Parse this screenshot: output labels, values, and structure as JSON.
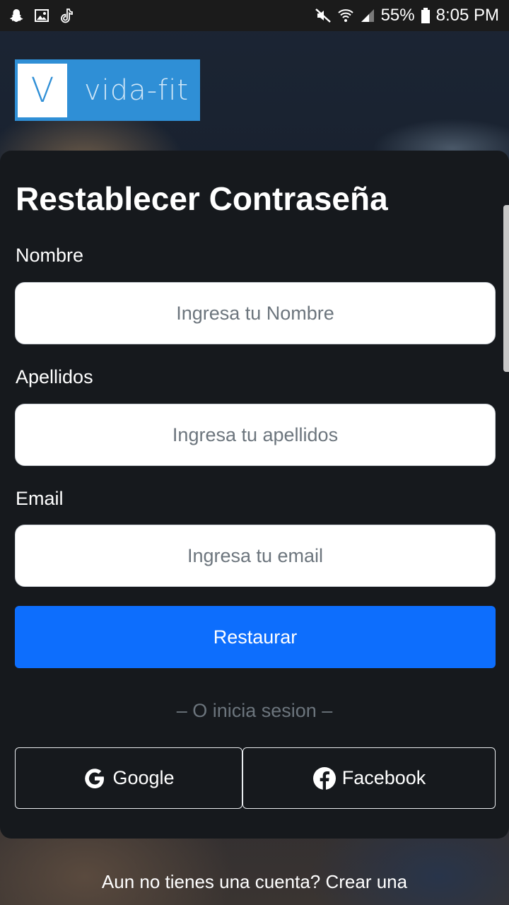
{
  "status_bar": {
    "battery": "55%",
    "time": "8:05 PM",
    "icons_left": [
      "snapchat-icon",
      "image-icon",
      "tiktok-icon"
    ],
    "icons_right": [
      "mute-icon",
      "wifi-icon",
      "signal-icon",
      "battery-icon"
    ]
  },
  "logo": {
    "mark": "V",
    "text": "vida-fit",
    "color": "#2f8fd6"
  },
  "form": {
    "title": "Restablecer Contraseña",
    "fields": [
      {
        "label": "Nombre",
        "placeholder": "Ingresa tu Nombre",
        "value": ""
      },
      {
        "label": "Apellidos",
        "placeholder": "Ingresa tu apellidos",
        "value": ""
      },
      {
        "label": "Email",
        "placeholder": "Ingresa tu email",
        "value": ""
      }
    ],
    "submit_label": "Restaurar",
    "submit_color": "#0d6efd"
  },
  "social": {
    "divider": "– O inicia sesion –",
    "google_label": "Google",
    "facebook_label": "Facebook"
  },
  "footer": {
    "text": "Aun no tienes una cuenta? Crear una"
  }
}
